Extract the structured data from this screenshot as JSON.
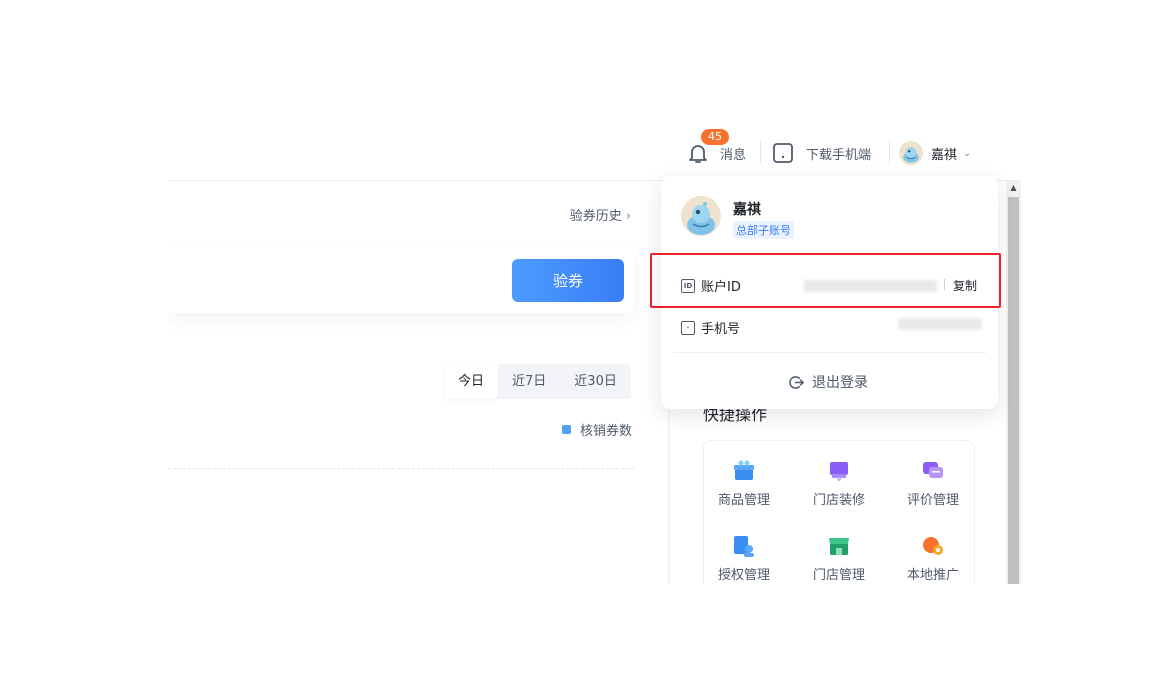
{
  "header": {
    "notifications_badge": "45",
    "notifications_label": "消息",
    "download_label": "下载手机端",
    "user_name": "嘉祺"
  },
  "main": {
    "history_link": "验券历史",
    "verify_button": "验券",
    "range_tabs": [
      "今日",
      "近7日",
      "近30日"
    ],
    "legend_label": "核销券数"
  },
  "side": {
    "quick_title": "快捷操作",
    "quick_items": [
      "商品管理",
      "门店装修",
      "评价管理",
      "授权管理",
      "门店管理",
      "本地推广"
    ]
  },
  "dropdown": {
    "name": "嘉祺",
    "account_tag": "总部子账号",
    "account_id_label": "账户ID",
    "copy_label": "复制",
    "phone_label": "手机号",
    "logout_label": "退出登录"
  },
  "colors": {
    "primary": "#3a7df6",
    "badge": "#f7712c",
    "highlight": "#e8232b"
  }
}
